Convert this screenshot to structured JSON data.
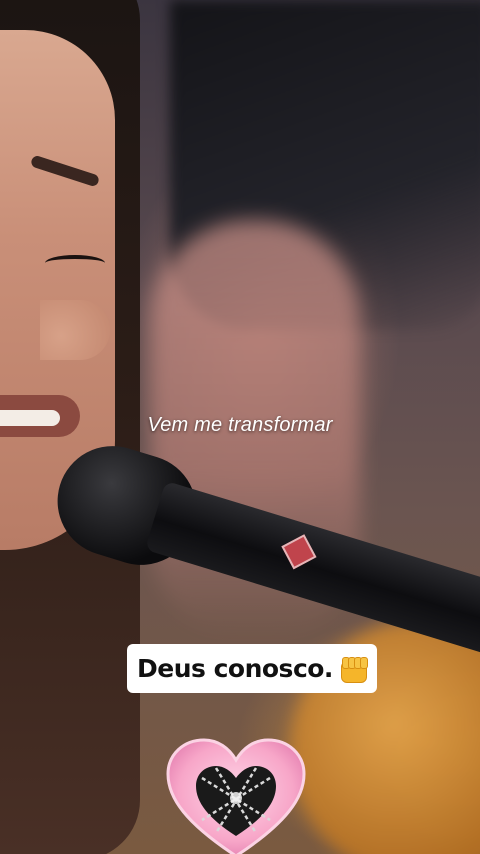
{
  "video": {
    "lyric_caption": "Vem me transformar",
    "sticker_text": "Deus conosco.",
    "sticker_emoji": "fist-icon",
    "heart_sticker": "heart-sticker-icon"
  },
  "colors": {
    "caption_text": "#ffffff",
    "sticker_bg": "#ffffff",
    "sticker_text": "#111111",
    "heart_outer": "#f7a6c8",
    "heart_inner": "#1a1a1a"
  }
}
